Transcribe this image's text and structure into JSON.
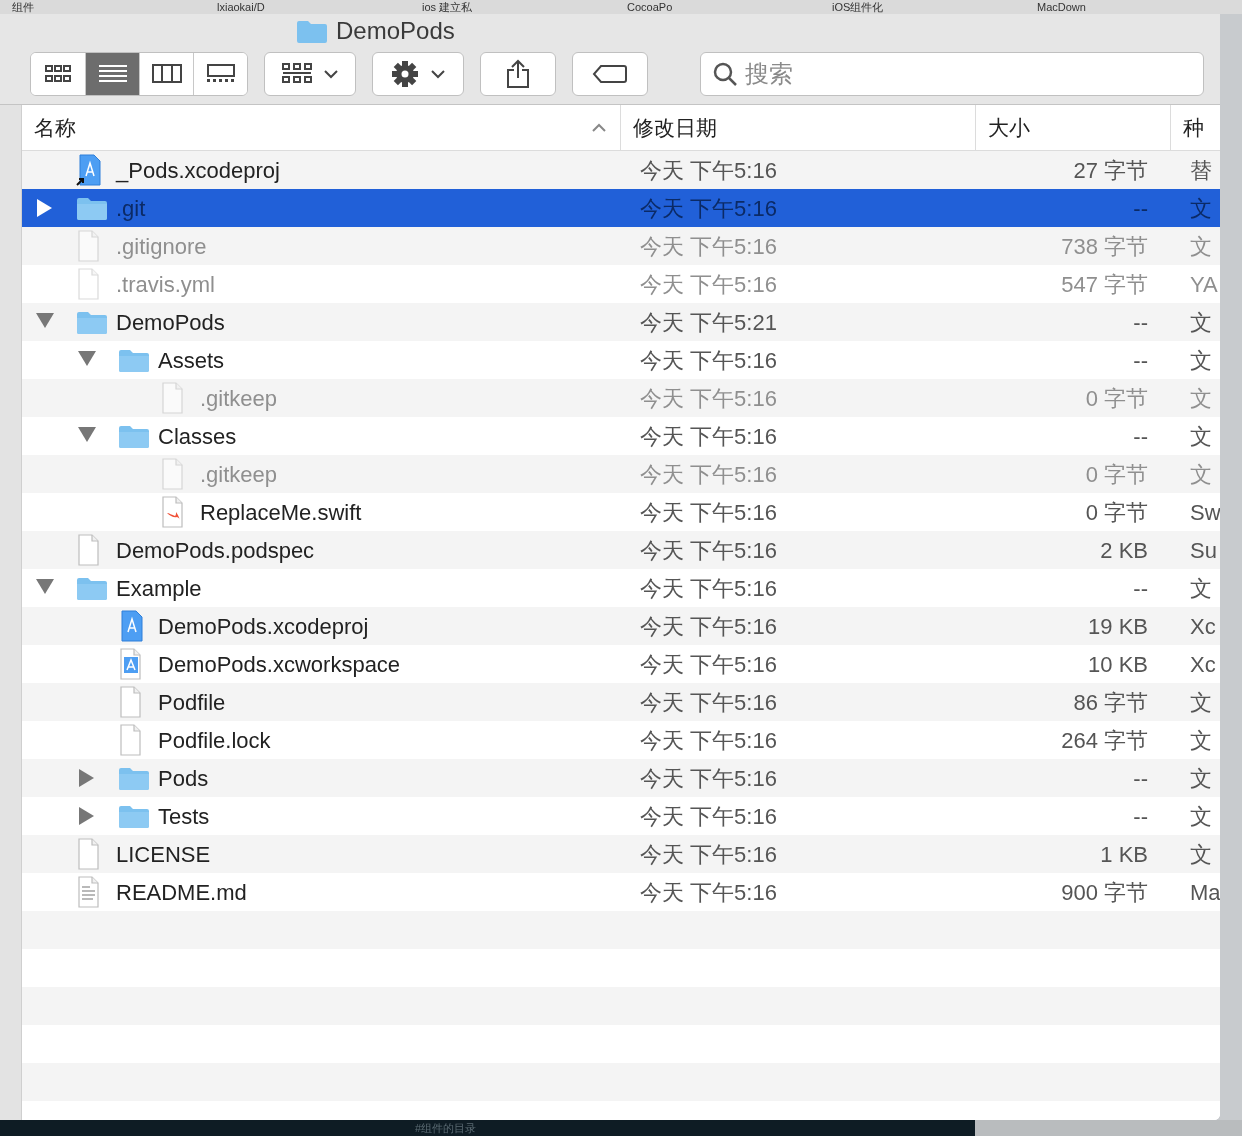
{
  "browser_tabs": [
    {
      "label": "组件"
    },
    {
      "label": "lxiaokai/D"
    },
    {
      "label": "ios 建立私"
    },
    {
      "label": "CocoaPo"
    },
    {
      "label": "iOS组件化"
    },
    {
      "label": "MacDown"
    }
  ],
  "window": {
    "title": "DemoPods"
  },
  "toolbar": {
    "view_modes": [
      {
        "kind": "icons",
        "selected": false
      },
      {
        "kind": "list",
        "selected": true
      },
      {
        "kind": "columns",
        "selected": false
      },
      {
        "kind": "gallery",
        "selected": false
      }
    ],
    "search": {
      "placeholder": "搜索"
    }
  },
  "columns": [
    {
      "label": "名称",
      "sorted": true
    },
    {
      "label": "修改日期",
      "sorted": false
    },
    {
      "label": "大小",
      "sorted": false
    },
    {
      "label": "种",
      "sorted": false
    }
  ],
  "files": [
    {
      "name": "_Pods.xcodeproj",
      "kind": "xcodeproj",
      "alias": true,
      "date": "今天 下午5:16",
      "size": "27 字节",
      "type": "替",
      "hidden": false,
      "selected": false
    },
    {
      "name": ".git",
      "kind": "folder",
      "expanded": false,
      "date": "今天 下午5:16",
      "size": "--",
      "type": "文",
      "hidden": true,
      "selected": true
    },
    {
      "name": ".gitignore",
      "kind": "file",
      "date": "今天 下午5:16",
      "size": "738 字节",
      "type": "文",
      "hidden": true,
      "selected": false
    },
    {
      "name": ".travis.yml",
      "kind": "file",
      "date": "今天 下午5:16",
      "size": "547 字节",
      "type": "YA",
      "hidden": true,
      "selected": false
    },
    {
      "name": "DemoPods",
      "kind": "folder",
      "expanded": true,
      "date": "今天 下午5:21",
      "size": "--",
      "type": "文",
      "hidden": false,
      "selected": false,
      "children": [
        {
          "name": "Assets",
          "kind": "folder",
          "expanded": true,
          "date": "今天 下午5:16",
          "size": "--",
          "type": "文",
          "hidden": false,
          "selected": false,
          "children": [
            {
              "name": ".gitkeep",
              "kind": "file",
              "date": "今天 下午5:16",
              "size": "0 字节",
              "type": "文",
              "hidden": true,
              "selected": false
            }
          ]
        },
        {
          "name": "Classes",
          "kind": "folder",
          "expanded": true,
          "date": "今天 下午5:16",
          "size": "--",
          "type": "文",
          "hidden": false,
          "selected": false,
          "children": [
            {
              "name": ".gitkeep",
              "kind": "file",
              "date": "今天 下午5:16",
              "size": "0 字节",
              "type": "文",
              "hidden": true,
              "selected": false
            },
            {
              "name": "ReplaceMe.swift",
              "kind": "swift",
              "date": "今天 下午5:16",
              "size": "0 字节",
              "type": "Sw",
              "hidden": false,
              "selected": false
            }
          ]
        }
      ]
    },
    {
      "name": "DemoPods.podspec",
      "kind": "file",
      "date": "今天 下午5:16",
      "size": "2 KB",
      "type": "Su",
      "hidden": false,
      "selected": false
    },
    {
      "name": "Example",
      "kind": "folder",
      "expanded": true,
      "date": "今天 下午5:16",
      "size": "--",
      "type": "文",
      "hidden": false,
      "selected": false,
      "children": [
        {
          "name": "DemoPods.xcodeproj",
          "kind": "xcodeproj",
          "date": "今天 下午5:16",
          "size": "19 KB",
          "type": "Xc",
          "hidden": false,
          "selected": false
        },
        {
          "name": "DemoPods.xcworkspace",
          "kind": "xcworkspace",
          "date": "今天 下午5:16",
          "size": "10 KB",
          "type": "Xc",
          "hidden": false,
          "selected": false
        },
        {
          "name": "Podfile",
          "kind": "file",
          "date": "今天 下午5:16",
          "size": "86 字节",
          "type": "文",
          "hidden": false,
          "selected": false
        },
        {
          "name": "Podfile.lock",
          "kind": "file",
          "date": "今天 下午5:16",
          "size": "264 字节",
          "type": "文",
          "hidden": false,
          "selected": false
        },
        {
          "name": "Pods",
          "kind": "folder",
          "expanded": false,
          "date": "今天 下午5:16",
          "size": "--",
          "type": "文",
          "hidden": false,
          "selected": false
        },
        {
          "name": "Tests",
          "kind": "folder",
          "expanded": false,
          "date": "今天 下午5:16",
          "size": "--",
          "type": "文",
          "hidden": false,
          "selected": false
        }
      ]
    },
    {
      "name": "LICENSE",
      "kind": "file",
      "date": "今天 下午5:16",
      "size": "1 KB",
      "type": "文",
      "hidden": false,
      "selected": false
    },
    {
      "name": "README.md",
      "kind": "text",
      "date": "今天 下午5:16",
      "size": "900 字节",
      "type": "Ma",
      "hidden": false,
      "selected": false
    }
  ],
  "footer_text": "#组件的目录"
}
